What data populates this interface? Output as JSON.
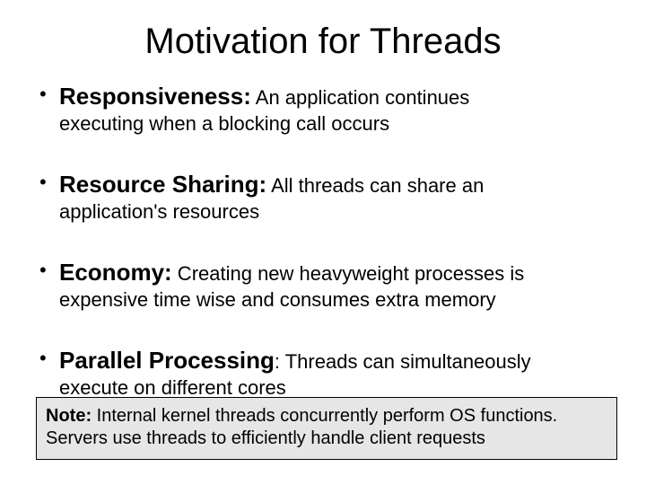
{
  "title": "Motivation for Threads",
  "bullets": [
    {
      "term": "Responsiveness:",
      "desc_lead": " An application continues",
      "desc_rest": "executing when a blocking call occurs"
    },
    {
      "term": "Resource Sharing:",
      "desc_lead": " All threads can share an",
      "desc_rest": "application's resources"
    },
    {
      "term": "Economy:",
      "desc_lead": " Creating new heavyweight processes is",
      "desc_rest": "expensive time wise and consumes extra memory"
    },
    {
      "term": "Parallel Processing",
      "desc_lead": ": Threads can simultaneously",
      "desc_rest": "execute on different cores"
    }
  ],
  "note": {
    "label": "Note:",
    "line1_rest": " Internal kernel threads concurrently perform OS functions.",
    "line2": "Servers use threads to efficiently handle client requests"
  }
}
